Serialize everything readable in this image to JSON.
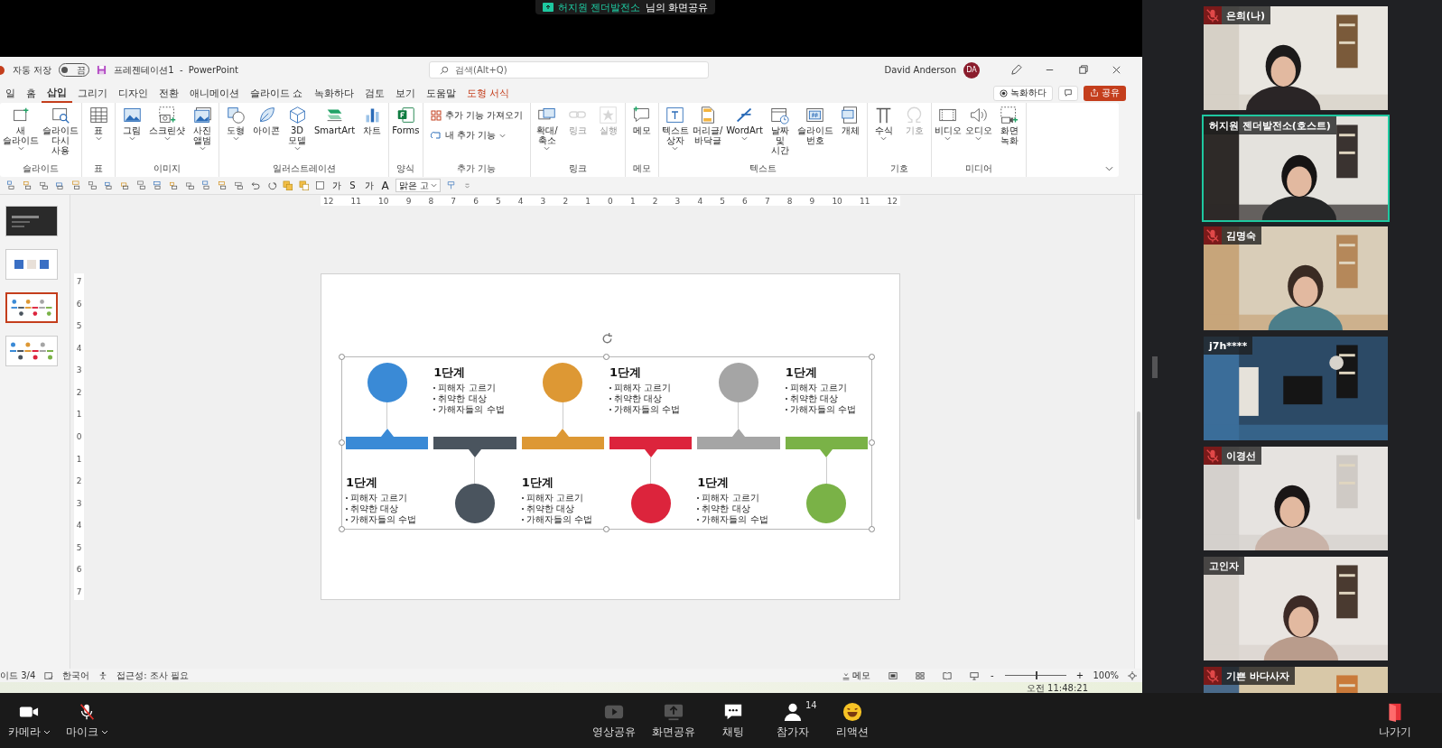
{
  "share_banner": {
    "presenter": "허지원 젠더발전소",
    "suffix": "님의 화면공유"
  },
  "powerpoint": {
    "title_bar": {
      "autosave_label": "자동 저장",
      "autosave_state": "끔",
      "autosave_on": false,
      "document_title": "프레젠테이션1  -  PowerPoint",
      "search_placeholder": "검색(Alt+Q)",
      "user_name": "David Anderson",
      "user_initials": "DA"
    },
    "tabs": [
      {
        "label": "일",
        "selected": false,
        "contextual": false
      },
      {
        "label": "홈",
        "selected": false,
        "contextual": false
      },
      {
        "label": "삽입",
        "selected": true,
        "contextual": false
      },
      {
        "label": "그리기",
        "selected": false,
        "contextual": false
      },
      {
        "label": "디자인",
        "selected": false,
        "contextual": false
      },
      {
        "label": "전환",
        "selected": false,
        "contextual": false
      },
      {
        "label": "애니메이션",
        "selected": false,
        "contextual": false
      },
      {
        "label": "슬라이드 쇼",
        "selected": false,
        "contextual": false
      },
      {
        "label": "녹화하다",
        "selected": false,
        "contextual": false
      },
      {
        "label": "검토",
        "selected": false,
        "contextual": false
      },
      {
        "label": "보기",
        "selected": false,
        "contextual": false
      },
      {
        "label": "도움말",
        "selected": false,
        "contextual": false
      },
      {
        "label": "도형 서식",
        "selected": false,
        "contextual": true
      }
    ],
    "record_button": "녹화하다",
    "share_button": "공유",
    "ribbon_groups": [
      {
        "label": "슬라이드",
        "buttons": [
          {
            "label": "새 슬라이드",
            "dropdown": true,
            "disabled": false
          },
          {
            "label": "슬라이드 다시 사용",
            "dropdown": false,
            "disabled": false
          }
        ]
      },
      {
        "label": "표",
        "buttons": [
          {
            "label": "표",
            "dropdown": true,
            "disabled": false
          }
        ]
      },
      {
        "label": "이미지",
        "buttons": [
          {
            "label": "그림",
            "dropdown": true,
            "disabled": false
          },
          {
            "label": "스크린샷",
            "dropdown": true,
            "disabled": false
          },
          {
            "label": "사진 앨범",
            "dropdown": true,
            "disabled": false
          }
        ]
      },
      {
        "label": "일러스트레이션",
        "buttons": [
          {
            "label": "도형",
            "dropdown": true,
            "disabled": false
          },
          {
            "label": "아이콘",
            "dropdown": false,
            "disabled": false
          },
          {
            "label": "3D 모델",
            "dropdown": true,
            "disabled": false
          },
          {
            "label": "SmartArt",
            "dropdown": false,
            "disabled": false
          },
          {
            "label": "차트",
            "dropdown": false,
            "disabled": false
          }
        ]
      },
      {
        "label": "양식",
        "buttons": [
          {
            "label": "Forms",
            "dropdown": false,
            "disabled": false
          }
        ]
      },
      {
        "label": "추가 기능",
        "rows": [
          {
            "label": "추가 기능 가져오기",
            "dropdown": false
          },
          {
            "label": "내 추가 기능",
            "dropdown": true
          }
        ]
      },
      {
        "label": "링크",
        "buttons": [
          {
            "label": "확대/축소",
            "dropdown": true,
            "disabled": false
          },
          {
            "label": "링크",
            "dropdown": false,
            "disabled": true
          },
          {
            "label": "실행",
            "dropdown": false,
            "disabled": true
          }
        ]
      },
      {
        "label": "메모",
        "buttons": [
          {
            "label": "메모",
            "dropdown": false,
            "disabled": false
          }
        ]
      },
      {
        "label": "텍스트",
        "buttons": [
          {
            "label": "텍스트 상자",
            "dropdown": true,
            "disabled": false
          },
          {
            "label": "머리글/바닥글",
            "dropdown": false,
            "disabled": false
          },
          {
            "label": "WordArt",
            "dropdown": true,
            "disabled": false
          },
          {
            "label": "날짜 및 시간",
            "dropdown": false,
            "disabled": false
          },
          {
            "label": "슬라이드 번호",
            "dropdown": false,
            "disabled": false
          },
          {
            "label": "개체",
            "dropdown": false,
            "disabled": false
          }
        ]
      },
      {
        "label": "기호",
        "buttons": [
          {
            "label": "수식",
            "dropdown": true,
            "disabled": false
          },
          {
            "label": "기호",
            "dropdown": false,
            "disabled": true
          }
        ]
      },
      {
        "label": "미디어",
        "buttons": [
          {
            "label": "비디오",
            "dropdown": true,
            "disabled": false
          },
          {
            "label": "오디오",
            "dropdown": true,
            "disabled": false
          },
          {
            "label": "화면 녹화",
            "dropdown": false,
            "disabled": false
          }
        ]
      }
    ],
    "format_toolbar": {
      "bold_glyph": "가",
      "shadow_glyph": "S",
      "size_glyph": "가",
      "font_glyph": "A",
      "font_name": "맑은 고"
    },
    "thumbnails": [
      {
        "selected": false
      },
      {
        "selected": false
      },
      {
        "selected": true
      },
      {
        "selected": false
      }
    ],
    "ruler_horizontal": [
      "12",
      "11",
      "10",
      "9",
      "8",
      "7",
      "6",
      "5",
      "4",
      "3",
      "2",
      "1",
      "0",
      "1",
      "2",
      "3",
      "4",
      "5",
      "6",
      "7",
      "8",
      "9",
      "10",
      "11",
      "12"
    ],
    "ruler_vertical": [
      "7",
      "6",
      "5",
      "4",
      "3",
      "2",
      "1",
      "0",
      "1",
      "2",
      "3",
      "4",
      "5",
      "6",
      "7"
    ],
    "stages": [
      {
        "color": "#3a8ad6",
        "kind": "top",
        "title": "1단계",
        "bullets": [
          "피해자 고르기",
          "취약한 대상",
          "가해자들의 수법"
        ]
      },
      {
        "color": "#4a545e",
        "kind": "bottom",
        "title": "1단계",
        "bullets": [
          "피해자 고르기",
          "취약한 대상",
          "가해자들의 수법"
        ]
      },
      {
        "color": "#dd9834",
        "kind": "top",
        "title": "1단계",
        "bullets": [
          "피해자 고르기",
          "취약한 대상",
          "가해자들의 수법"
        ]
      },
      {
        "color": "#dc243c",
        "kind": "bottom",
        "title": "1단계",
        "bullets": [
          "피해자 고르기",
          "취약한 대상",
          "가해자들의 수법"
        ]
      },
      {
        "color": "#a5a5a5",
        "kind": "top",
        "title": "1단계",
        "bullets": [
          "피해자 고르기",
          "취약한 대상",
          "가해자들의 수법"
        ]
      },
      {
        "color": "#7ab247",
        "kind": "bottom",
        "title": "1단계",
        "bullets": [
          "피해자 고르기",
          "취약한 대상",
          "가해자들의 수법"
        ]
      }
    ],
    "status_bar": {
      "slide_counter": "이드 3/4",
      "language": "한국어",
      "accessibility": "접근성: 조사 필요",
      "notes_button": "메모",
      "zoom_out": "-",
      "zoom_in": "+",
      "zoom": {
        "level": 0.5
      },
      "zoom_percent": "100%"
    },
    "taskbar_clock": "오전 11:48:21"
  },
  "participants": [
    {
      "name": "은희(나)",
      "muted": true,
      "speaking": false
    },
    {
      "name": "허지원 젠더발전소(호스트)",
      "muted": false,
      "speaking": true
    },
    {
      "name": "김명숙",
      "muted": true,
      "speaking": false
    },
    {
      "name": "j7h****",
      "muted": false,
      "speaking": false
    },
    {
      "name": "이경선",
      "muted": true,
      "speaking": false
    },
    {
      "name": "고인자",
      "muted": false,
      "speaking": false
    },
    {
      "name": "기쁜 바다사자",
      "muted": true,
      "speaking": false
    }
  ],
  "controls": {
    "camera": "카메라",
    "mic": "마이크",
    "mic_muted": true,
    "center": [
      {
        "label": "영상공유",
        "kind": "video"
      },
      {
        "label": "화면공유",
        "kind": "screen"
      },
      {
        "label": "채팅",
        "kind": "chat"
      },
      {
        "label": "참가자",
        "kind": "people",
        "count": "14"
      },
      {
        "label": "리액션",
        "kind": "reaction"
      }
    ],
    "leave": "나가기"
  }
}
